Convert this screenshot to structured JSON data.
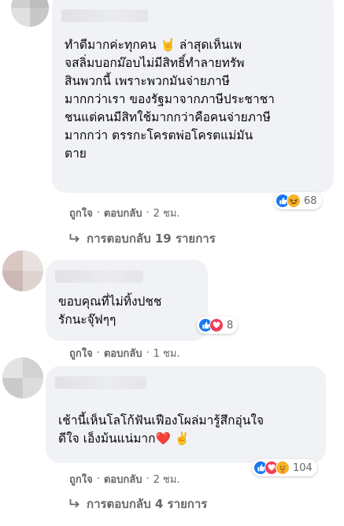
{
  "comments": [
    {
      "text": "ทำดีมากค่ะทุกคน 🤘 ล่าสุดเห็นเพ\nจสลิ่มบอกม๊อบไม่มีสิทธิ์ทำลายทรัพ\nสินพวกนี้ เพราะพวกมันจ่ายภาษี\nมากกว่าเรา ของรัฐมาจากภาษีประชาชา\nชนแต่คนมีสิทใช้มากกว่าคือคนจ่ายภาษี\nมากกว่า ตรรกะโครตพ่อโครตแม่มัน\nตาย",
      "reaction_count": "68",
      "like_label": "ถูกใจ",
      "reply_label": "ตอบกลับ",
      "time": "2 ชม.",
      "view_replies": "การตอบกลับ 19 รายการ"
    },
    {
      "text": "ขอบคุณที่ไม่ทิ้งปชช\nรักนะจุ๊ฟๆๆ",
      "reaction_count": "8",
      "like_label": "ถูกใจ",
      "reply_label": "ตอบกลับ",
      "time": "1 ชม."
    },
    {
      "text": "เช้านี้เห็นโลโก้ฟันเฟืองโผล่มารู้สึกอุ่นใจ\nดีใจ เอ็งม้นแน่มาก❤️ ✌️",
      "reaction_count": "104",
      "like_label": "ถูกใจ",
      "reply_label": "ตอบกลับ",
      "time": "2 ชม.",
      "view_replies": "การตอบกลับ 4 รายการ"
    }
  ],
  "separator": "·",
  "colors": {
    "bubble": "#f0f2f5",
    "secondary_text": "#65676b",
    "like_blue": "#1877f2",
    "love_red": "#f33e58",
    "haha_yellow": "#f7b125"
  },
  "icons": [
    "reply-arrow-icon",
    "like-reaction-icon",
    "haha-reaction-icon",
    "love-reaction-icon",
    "care-reaction-icon"
  ]
}
